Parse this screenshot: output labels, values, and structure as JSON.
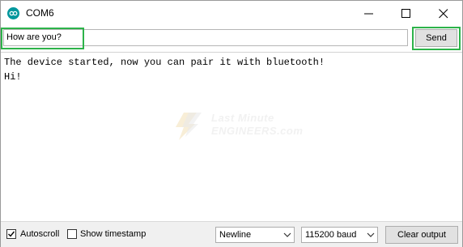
{
  "window": {
    "title": "COM6"
  },
  "input": {
    "value": "How are you?",
    "send_label": "Send"
  },
  "output": {
    "lines": [
      "The device started, now you can pair it with bluetooth!",
      "Hi!"
    ],
    "watermark": {
      "line1": "Last Minute",
      "line2": "ENGINEERS.com"
    }
  },
  "footer": {
    "autoscroll_label": "Autoscroll",
    "autoscroll_checked": true,
    "timestamp_label": "Show timestamp",
    "timestamp_checked": false,
    "line_ending": "Newline",
    "baud": "115200 baud",
    "clear_label": "Clear output"
  },
  "colors": {
    "highlight": "#2db34a",
    "arduino_teal": "#00979d"
  }
}
